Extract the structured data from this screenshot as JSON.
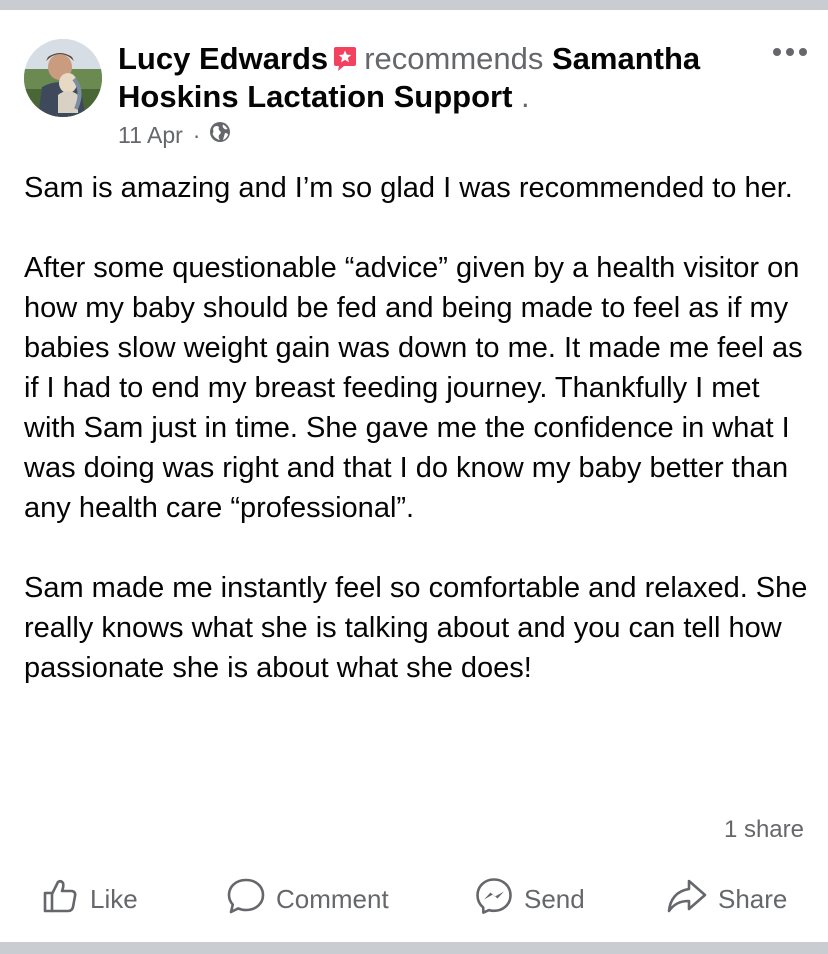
{
  "post": {
    "author": "Lucy Edwards",
    "verb": "recommends",
    "page_name": "Samantha Hoskins Lactation Support",
    "trailing_dot": ".",
    "date": "11 Apr",
    "meta_sep": "·",
    "paragraphs": [
      "Sam is amazing and I’m so glad I was recommended to her.",
      "After some questionable “advice” given by a health visitor on how my baby should be fed and being made to feel as if my babies slow weight gain was down to me. It made me feel as if I had to end my breast feeding journey. Thankfully I met with Sam just in time. She gave me the confidence in what I was doing was right and that I do know my baby better than any health care “professional”.",
      "Sam made me instantly feel so comfortable and relaxed. She really knows what she is talking about and you can tell how passionate she is about what she does!"
    ],
    "shares": "1 share"
  },
  "actions": {
    "like": "Like",
    "comment": "Comment",
    "send": "Send",
    "share": "Share"
  },
  "icons": {
    "recommend_badge": "recommend-star-icon",
    "privacy": "globe-icon",
    "more": "more-horizontal-icon"
  },
  "colors": {
    "recommend_badge": "#f3425f",
    "secondary_text": "#65676b",
    "primary_text": "#050505",
    "divider_bars": "#c9ccd1"
  }
}
